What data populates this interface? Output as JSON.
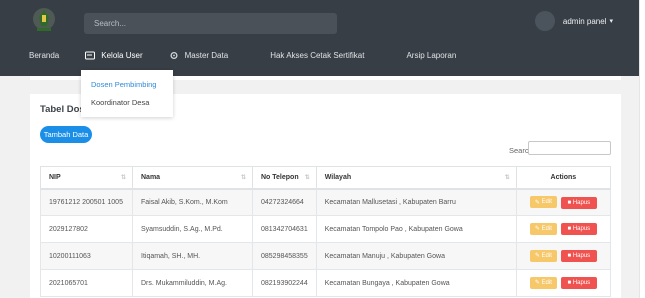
{
  "header": {
    "search_placeholder": "Search...",
    "admin_label": "admin panel"
  },
  "menu": [
    {
      "label": "Beranda",
      "icon": "grid-icon"
    },
    {
      "label": "Kelola User",
      "icon": "id-card-icon"
    },
    {
      "label": "Master Data",
      "icon": "gear-icon"
    },
    {
      "label": "Hak Akses Cetak Sertifikat",
      "icon": "grid-icon"
    },
    {
      "label": "Arsip Laporan",
      "icon": "grid-icon"
    }
  ],
  "dropdown": {
    "items": [
      "Dosen Pembimbing",
      "Koordinator Desa"
    ]
  },
  "card": {
    "title": "Tabel Dose",
    "add_button": "Tambah Data",
    "search_label": "Search:"
  },
  "table": {
    "columns": [
      "NIP",
      "Nama",
      "No Telepon",
      "Wilayah",
      "Actions"
    ],
    "edit_label": "Edit",
    "delete_label": "Hapus",
    "rows": [
      {
        "nip": "19761212 200501 1005",
        "nama": "Faisal Akib, S.Kom., M.Kom",
        "telepon": "04272324664",
        "wilayah": "Kecamatan Mallusetasi , Kabupaten Barru"
      },
      {
        "nip": "2029127802",
        "nama": "Syamsuddin, S.Ag., M.Pd.",
        "telepon": "081342704631",
        "wilayah": "Kecamatan Tompolo Pao , Kabupaten Gowa"
      },
      {
        "nip": "10200111063",
        "nama": "Itiqamah, SH., MH.",
        "telepon": "085298458355",
        "wilayah": "Kecamatan Manuju , Kabupaten Gowa"
      },
      {
        "nip": "2021065701",
        "nama": "Drs. Mukammiluddin, M.Ag.",
        "telepon": "082193902244",
        "wilayah": "Kecamatan Bungaya , Kabupaten Gowa"
      }
    ]
  },
  "colors": {
    "header_bg": "#373e45",
    "primary": "#1b8ee8",
    "edit": "#f6c86a",
    "delete": "#f0524f",
    "logo_green": "#2f6a2b"
  }
}
